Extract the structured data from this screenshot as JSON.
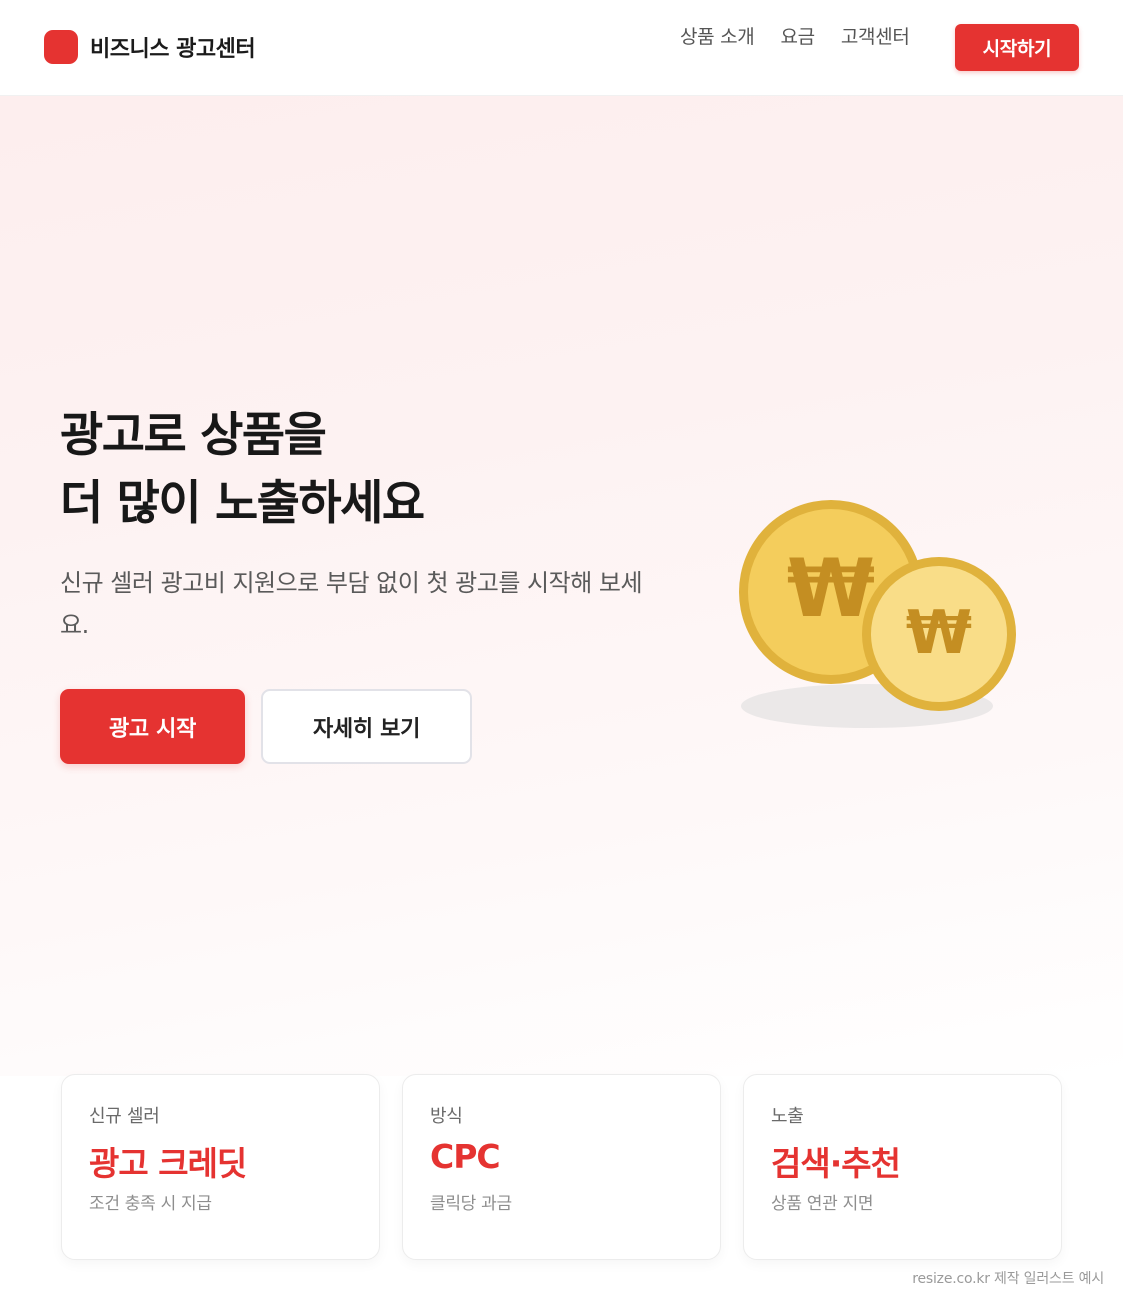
{
  "header": {
    "brand_name": "비즈니스 광고센터",
    "nav": [
      "상품 소개",
      "요금",
      "고객센터"
    ],
    "cta_label": "시작하기"
  },
  "hero": {
    "title_line1": "광고로 상품을",
    "title_line2": "더 많이 노출하세요",
    "subtitle": "신규 셀러 광고비 지원으로 부담 없이 첫 광고를 시작해 보세요.",
    "primary_button": "광고 시작",
    "secondary_button": "자세히 보기",
    "coin_symbol": "₩"
  },
  "cards": [
    {
      "label": "신규 셀러",
      "value": "광고 크레딧",
      "note": "조건 충족 시 지급"
    },
    {
      "label": "방식",
      "value": "CPC",
      "note": "클릭당 과금"
    },
    {
      "label": "노출",
      "value": "검색·추천",
      "note": "상품 연관 지면"
    }
  ],
  "footer": {
    "credit": "resize.co.kr 제작 일러스트 예시"
  },
  "colors": {
    "accent": "#e53331",
    "coin_gold": "#f4cd5c",
    "coin_edge": "#e0b23c",
    "coin_symbol": "#c48e22"
  }
}
